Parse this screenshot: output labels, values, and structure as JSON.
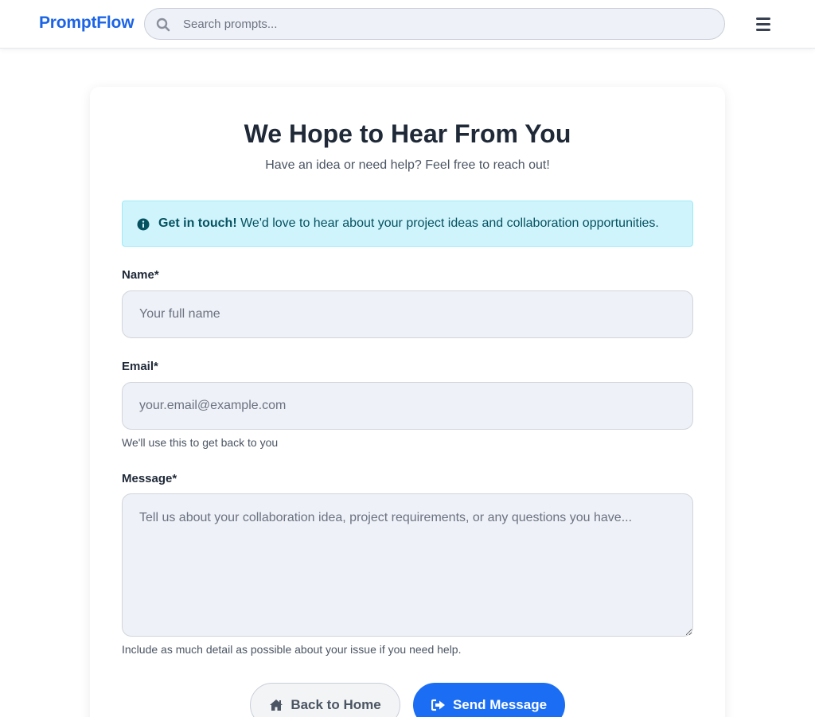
{
  "navbar": {
    "brand": "PromptFlow",
    "search_placeholder": "Search prompts..."
  },
  "page": {
    "title": "We Hope to Hear From You",
    "subtitle": "Have an idea or need help? Feel free to reach out!"
  },
  "alert": {
    "strong": "Get in touch!",
    "text": "We'd love to hear about your project ideas and collaboration opportunities."
  },
  "form": {
    "name_label": "Name*",
    "name_placeholder": "Your full name",
    "email_label": "Email*",
    "email_placeholder": "your.email@example.com",
    "email_help": "We'll use this to get back to you",
    "message_label": "Message*",
    "message_placeholder": "Tell us about your collaboration idea, project requirements, or any questions you have...",
    "message_help": "Include as much detail as possible about your issue if you need help."
  },
  "actions": {
    "back_label": "Back to Home",
    "send_label": "Send Message"
  },
  "icons": {
    "search": "search-icon",
    "menu": "hamburger-menu-icon",
    "info": "info-circle-icon",
    "home": "home-icon",
    "send": "sign-out-arrow-icon"
  },
  "colors": {
    "brand": "#1c64e6",
    "primary_button": "#1b6ef3",
    "alert_bg": "#cff4fc",
    "alert_text": "#055160",
    "input_bg": "#eef1f7"
  }
}
